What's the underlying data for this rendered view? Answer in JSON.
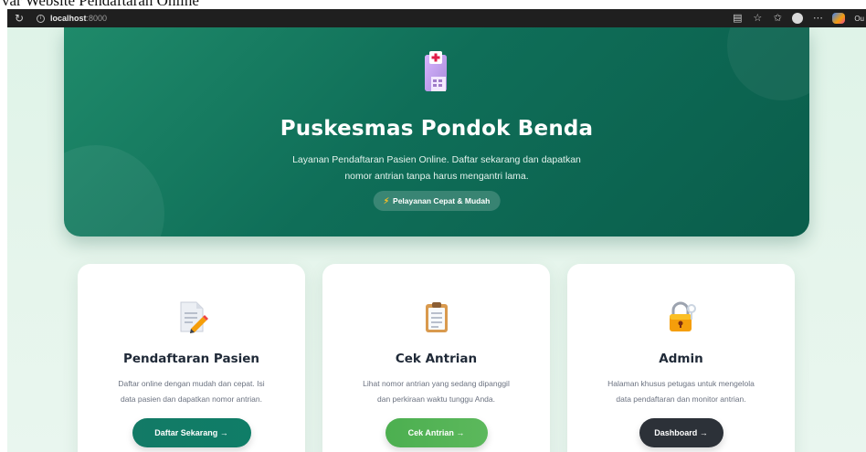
{
  "caption": "var Website Pendaftaran Online",
  "browser": {
    "url_host": "localhost",
    "url_port": ":8000",
    "profile_label": "Ou"
  },
  "hero": {
    "title": "Puskesmas Pondok Benda",
    "subtitle_line1": "Layanan Pendaftaran Pasien Online. Daftar sekarang dan dapatkan",
    "subtitle_line2": "nomor antrian tanpa harus mengantri lama.",
    "badge_icon": "lightning-icon",
    "badge_label": "Pelayanan Cepat & Mudah",
    "icon": "hospital-building-icon"
  },
  "cards": [
    {
      "icon": "memo-pencil-icon",
      "title": "Pendaftaran Pasien",
      "desc_line1": "Daftar online dengan mudah dan cepat. Isi",
      "desc_line2": "data pasien dan dapatkan nomor antrian.",
      "button_label": "Daftar Sekarang →",
      "button_color": "#137a66"
    },
    {
      "icon": "clipboard-icon",
      "title": "Cek Antrian",
      "desc_line1": "Lihat nomor antrian yang sedang dipanggil",
      "desc_line2": "dan perkiraan waktu tunggu Anda.",
      "button_label": "Cek Antrian →",
      "button_color": "#4caf50"
    },
    {
      "icon": "lock-key-icon",
      "title": "Admin",
      "desc_line1": "Halaman khusus petugas untuk mengelola",
      "desc_line2": "data pendaftaran dan monitor antrian.",
      "button_label": "Dashboard →",
      "button_color": "#2c3138"
    }
  ],
  "colors": {
    "hero_bg": "#0f6e58",
    "page_bg": "#dff3e8",
    "accent_green": "#4caf50",
    "dark_button": "#2c3138"
  }
}
